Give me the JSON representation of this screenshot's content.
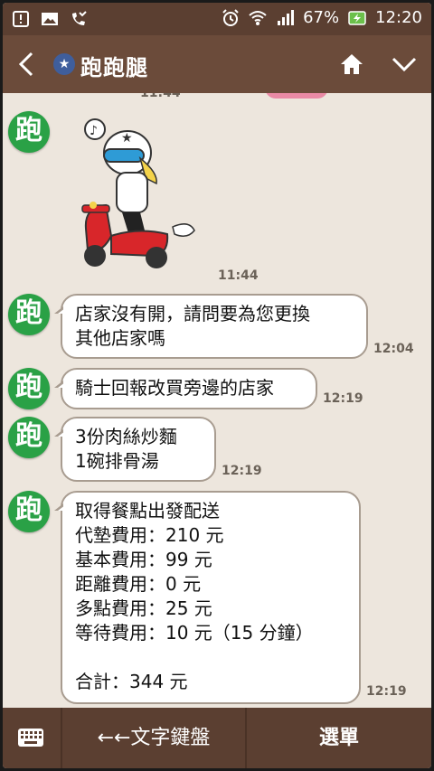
{
  "status_bar": {
    "battery_percent": "67%",
    "clock": "12:20"
  },
  "header": {
    "title": "跑跑腿"
  },
  "avatar_glyph": "跑",
  "chat": {
    "prev_time": "11:44",
    "sticker_time": "11:44",
    "messages": [
      {
        "text": "店家沒有開，請問要為您更換\n其他店家嗎",
        "time": "12:04"
      },
      {
        "text": "騎士回報改買旁邊的店家",
        "time": "12:19"
      },
      {
        "text": "3份肉絲炒麵\n1碗排骨湯",
        "time": "12:19"
      },
      {
        "text": "取得餐點出發配送\n代墊費用：210 元\n基本費用：99 元\n距離費用：0 元\n多點費用：25 元\n等待費用：10 元（15 分鐘）\n\n合計：344 元",
        "time": "12:19"
      }
    ]
  },
  "bottom_bar": {
    "keyboard_label": "←←文字鍵盤",
    "menu_label": "選單"
  },
  "colors": {
    "header_bg": "#6b4b3a",
    "status_bg": "#5b3f31",
    "chat_bg": "#ede6dd",
    "avatar_green": "#2aa146"
  }
}
